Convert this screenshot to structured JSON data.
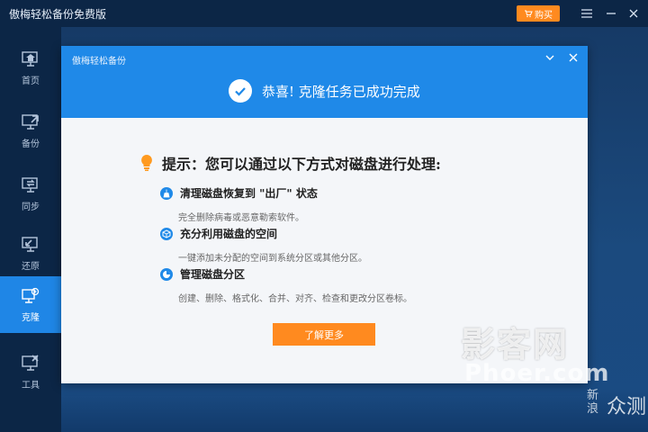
{
  "app": {
    "title": "傲梅轻松备份免费版",
    "buy_label": "购买"
  },
  "sidebar": {
    "items": [
      {
        "label": "首页",
        "icon": "home-monitor-icon"
      },
      {
        "label": "备份",
        "icon": "backup-monitor-icon"
      },
      {
        "label": "同步",
        "icon": "sync-monitor-icon"
      },
      {
        "label": "还原",
        "icon": "restore-monitor-icon"
      },
      {
        "label": "克隆",
        "icon": "clone-monitor-icon",
        "active": true
      },
      {
        "label": "工具",
        "icon": "tools-monitor-icon"
      }
    ]
  },
  "dialog": {
    "title": "傲梅轻松备份",
    "success_message": "恭喜! 克隆任务已成功完成",
    "tip_title": "提示：您可以通过以下方式对磁盘进行处理:",
    "options": [
      {
        "title": "清理磁盘恢复到 \"出厂\" 状态",
        "desc": "完全删除病毒或恶意勒索软件。",
        "icon": "broom-icon"
      },
      {
        "title": "充分利用磁盘的空间",
        "desc": "一键添加未分配的空间到系统分区或其他分区。",
        "icon": "box-icon"
      },
      {
        "title": "管理磁盘分区",
        "desc": "创建、删除、格式化、合并、对齐、检查和更改分区卷标。",
        "icon": "pie-chart-icon"
      }
    ],
    "learn_more_label": "了解更多"
  },
  "watermark": {
    "main": "影客网",
    "url": "Phoer.com",
    "sina": "新浪",
    "zc": "众测"
  },
  "colors": {
    "accent": "#1f89e8",
    "orange": "#ff8a1f",
    "sidebar_bg": "#0c2646"
  }
}
